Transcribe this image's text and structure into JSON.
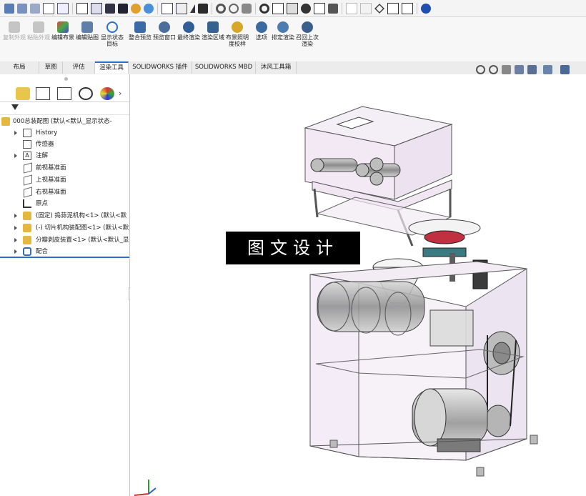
{
  "command_manager": {
    "buttons": [
      {
        "label": "复制外观",
        "enabled": false
      },
      {
        "label": "粘贴外观",
        "enabled": false
      },
      {
        "label": "编辑布景",
        "enabled": true
      },
      {
        "label": "编辑贴图",
        "enabled": true
      },
      {
        "label": "显示状态目标",
        "enabled": true
      },
      {
        "label": "整合预览",
        "enabled": true
      },
      {
        "label": "预览窗口",
        "enabled": true
      },
      {
        "label": "最终渲染",
        "enabled": true
      },
      {
        "label": "渲染区域",
        "enabled": true
      },
      {
        "label": "布景照明度校样",
        "enabled": true
      },
      {
        "label": "选项",
        "enabled": true
      },
      {
        "label": "排定渲染",
        "enabled": true
      },
      {
        "label": "召回上次渲染",
        "enabled": true
      }
    ]
  },
  "tabs": [
    {
      "label": "布局"
    },
    {
      "label": "草图"
    },
    {
      "label": "评估"
    },
    {
      "label": "渲染工具",
      "active": true
    },
    {
      "label": "SOLIDWORKS 插件"
    },
    {
      "label": "SOLIDWORKS MBD"
    },
    {
      "label": "沐风工具箱"
    }
  ],
  "feature_tree": {
    "root": "000总装配图  (默认<默认_显示状态-",
    "items": [
      {
        "label": "History",
        "icon": "history-icon",
        "expandable": true
      },
      {
        "label": "传感器",
        "icon": "sensor-icon",
        "expandable": false
      },
      {
        "label": "注解",
        "icon": "annotation-icon",
        "expandable": true
      },
      {
        "label": "前视基准面",
        "icon": "plane-icon",
        "expandable": false
      },
      {
        "label": "上视基准面",
        "icon": "plane-icon",
        "expandable": false
      },
      {
        "label": "右视基准面",
        "icon": "plane-icon",
        "expandable": false
      },
      {
        "label": "原点",
        "icon": "origin-icon",
        "expandable": false
      },
      {
        "label": "(固定) 捣蒜泥机构<1> (默认<默",
        "icon": "subassembly-icon",
        "expandable": true
      },
      {
        "label": "(-) 切片机构装配图<1> (默认<默",
        "icon": "subassembly-icon",
        "expandable": true
      },
      {
        "label": "分瓣剥皮装置<1> (默认<默认_显",
        "icon": "subassembly-icon",
        "expandable": true
      },
      {
        "label": "配合",
        "icon": "mates-icon",
        "expandable": true
      }
    ]
  },
  "watermark": {
    "text": "图文设计"
  },
  "colors": {
    "accent": "#2a6fd0",
    "frame": "#efe4f2",
    "watermark_bg": "#000000"
  }
}
